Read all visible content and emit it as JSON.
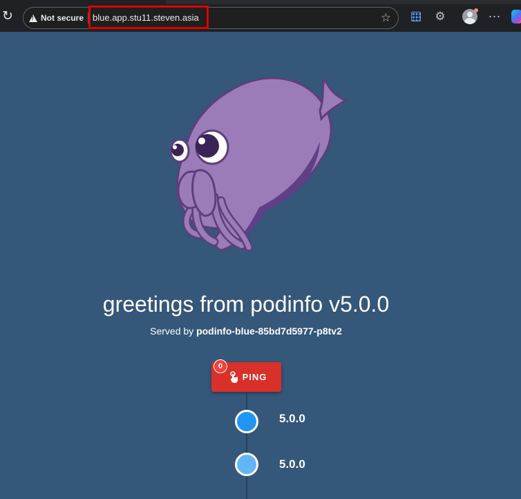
{
  "browser": {
    "security_label": "Not secure",
    "url": "blue.app.stu11.steven.asia",
    "icons": [
      "reload-icon",
      "warning-icon",
      "star-icon",
      "apps-icon",
      "extensions-icon",
      "profile-icon",
      "more-icon",
      "copilot-icon"
    ]
  },
  "page": {
    "title": "greetings from podinfo v5.0.0",
    "served_prefix": "Served by",
    "served_host": "podinfo-blue-85bd7d5977-p8tv2",
    "ping_label": "PING",
    "ping_count": "0",
    "versions": [
      "5.0.0",
      "5.0.0"
    ]
  },
  "colors": {
    "background": "#34577a",
    "ping": "#d9302a",
    "badge": "#f44336",
    "dot1": "#2196f3",
    "dot2": "#64b5f6",
    "mascot": "#9b7bb8",
    "url_highlight": "#e00000"
  }
}
